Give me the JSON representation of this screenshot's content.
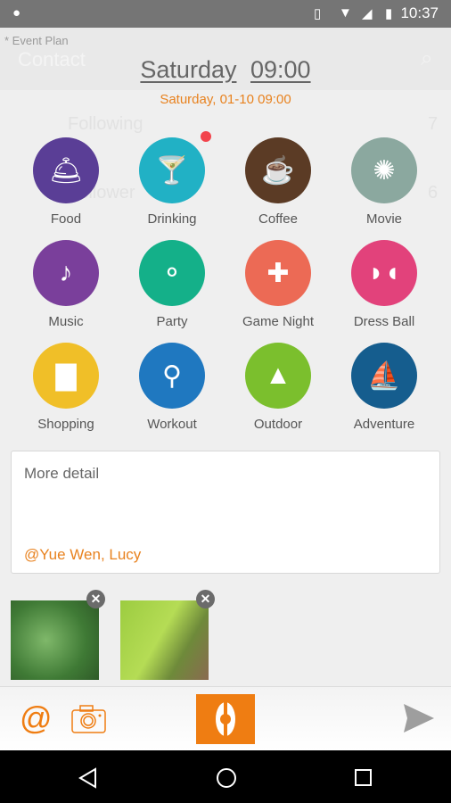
{
  "status": {
    "time": "10:37",
    "icons": [
      "android-icon",
      "vibrate-icon",
      "wifi-icon",
      "signal-icon",
      "battery-charging-icon"
    ]
  },
  "background": {
    "title": "Contact",
    "rows": [
      {
        "label": "Following",
        "count": "7"
      },
      {
        "label": "Follower",
        "count": "6"
      }
    ]
  },
  "header": {
    "label": "* Event Plan",
    "day": "Saturday",
    "time": "09:00",
    "full": "Saturday, 01-10 09:00"
  },
  "categories": [
    {
      "label": "Food",
      "color": "#5a3e96",
      "icon": "cloche-icon"
    },
    {
      "label": "Drinking",
      "color": "#21b1c5",
      "icon": "cocktail-icon",
      "badge": true
    },
    {
      "label": "Coffee",
      "color": "#5b3b25",
      "icon": "coffee-cup-icon"
    },
    {
      "label": "Movie",
      "color": "#8ba89f",
      "icon": "film-reel-icon"
    },
    {
      "label": "Music",
      "color": "#7a3f9b",
      "icon": "guitar-icon"
    },
    {
      "label": "Party",
      "color": "#14b089",
      "icon": "balloons-icon"
    },
    {
      "label": "Game Night",
      "color": "#ec6a55",
      "icon": "gamepad-icon"
    },
    {
      "label": "Dress Ball",
      "color": "#e2427b",
      "icon": "mask-icon"
    },
    {
      "label": "Shopping",
      "color": "#f0bf28",
      "icon": "shopping-bag-icon"
    },
    {
      "label": "Workout",
      "color": "#1f78c0",
      "icon": "bicycle-icon"
    },
    {
      "label": "Outdoor",
      "color": "#7bbf2d",
      "icon": "mountains-icon"
    },
    {
      "label": "Adventure",
      "color": "#155d8e",
      "icon": "sailboat-icon"
    }
  ],
  "detail": {
    "placeholder": "More detail",
    "mentions": "@Yue Wen, Lucy"
  },
  "toolbar": {
    "accent": "#ef7d12"
  }
}
